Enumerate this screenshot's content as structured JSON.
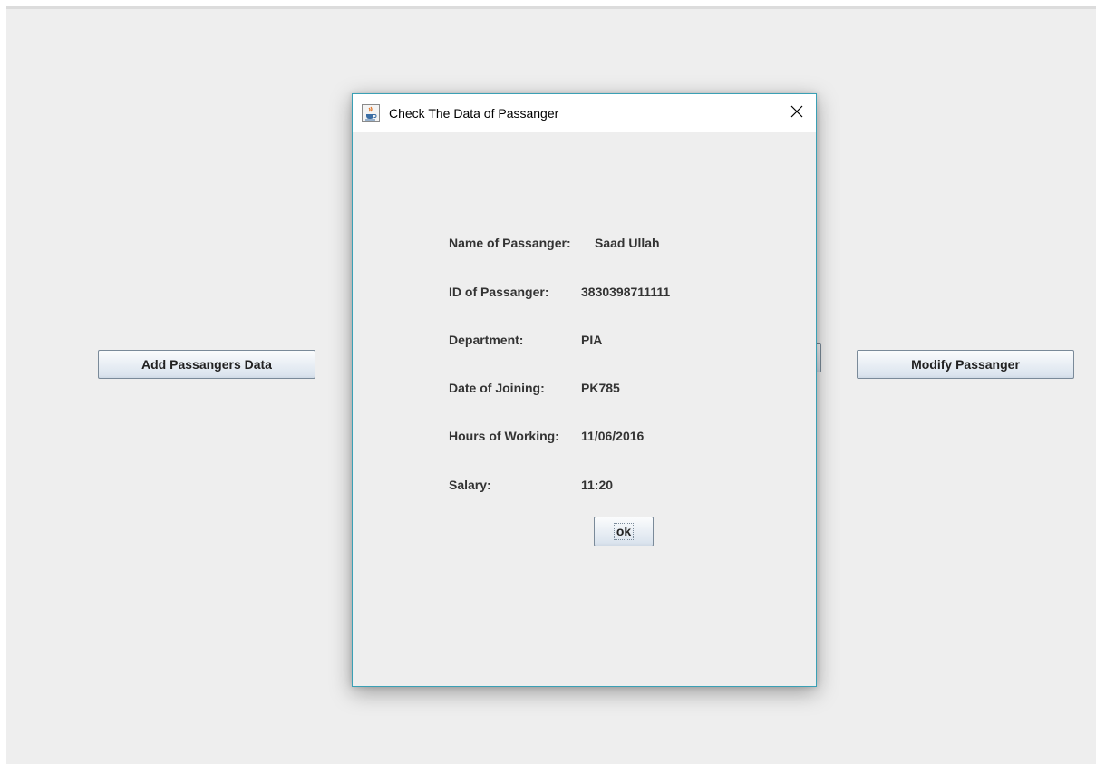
{
  "main_window": {
    "add_button_label": "Add Passangers Data",
    "modify_button_label": "Modify Passanger"
  },
  "dialog": {
    "title": "Check The Data of Passanger",
    "title_icon": "java-cup-icon",
    "close_icon": "close-icon",
    "fields": [
      {
        "label": "Name of Passanger:",
        "value": "Saad Ullah"
      },
      {
        "label": "ID of Passanger:",
        "value": "3830398711111"
      },
      {
        "label": "Department:",
        "value": "PIA"
      },
      {
        "label": "Date of Joining:",
        "value": "PK785"
      },
      {
        "label": "Hours of Working:",
        "value": "11/06/2016"
      },
      {
        "label": "Salary:",
        "value": "11:20"
      }
    ],
    "ok_label": "ok"
  },
  "colors": {
    "window_background": "#eeeeee",
    "dialog_border": "#3aa0b5",
    "button_border": "#7a8a99",
    "text": "#333333"
  }
}
